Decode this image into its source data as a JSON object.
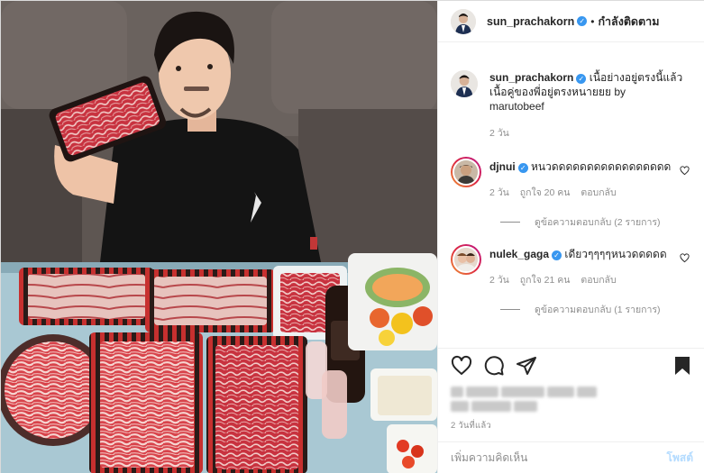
{
  "header": {
    "username": "sun_prachakorn",
    "verified_icon": "verified-badge-icon",
    "separator": "•",
    "follow_label": "กำลังติดตาม"
  },
  "caption": {
    "username": "sun_prachakorn",
    "text": "เนื้อย่างอยู่ตรงนี้แล้วเนื้อคู่ของพี่อยู่ตรงหนายยย by marutobeef",
    "time": "2 วัน"
  },
  "comments": [
    {
      "username": "djnui",
      "text": "หนวดดดดดดดดดดดดดดดดด",
      "time": "2 วัน",
      "likes": "ถูกใจ 20 คน",
      "reply_label": "ตอบกลับ",
      "view_replies": "ดูข้อความตอบกลับ (2 รายการ)"
    },
    {
      "username": "nulek_gaga",
      "text": "เดียวๆๆๆๆหนวดดดดด",
      "time": "2 วัน",
      "likes": "ถูกใจ 21 คน",
      "reply_label": "ตอบกลับ",
      "view_replies": "ดูข้อความตอบกลับ (1 รายการ)"
    }
  ],
  "actions": {
    "like_icon": "heart-icon",
    "comment_icon": "comment-icon",
    "share_icon": "paper-plane-icon",
    "save_icon": "bookmark-icon"
  },
  "post_time": "2 วันที่แล้ว",
  "add_comment": {
    "placeholder": "เพิ่มความคิดเห็น",
    "post_label": "โพสต์"
  },
  "colors": {
    "verified": "#3897f0",
    "muted": "#8e8e8e",
    "post_button": "#b3dbff"
  }
}
